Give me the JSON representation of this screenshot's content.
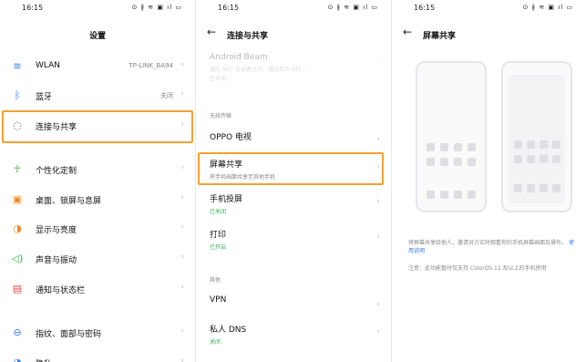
{
  "status": {
    "time": "16:15",
    "icons": "⊙ ∦ ≋ ▣ ıl ▭"
  },
  "settings": {
    "title": "设置",
    "items": [
      {
        "icon": "wifi-icon",
        "glyph": "≋",
        "color": "#2d7bf6",
        "label": "WLAN",
        "value": "TP-LINK_BA94"
      },
      {
        "icon": "bluetooth-icon",
        "glyph": "ᛒ",
        "color": "#2d7bf6",
        "label": "蓝牙",
        "value": "关闭"
      },
      {
        "icon": "connection-share-icon",
        "glyph": "◌",
        "color": "#555555",
        "label": "连接与共享",
        "value": ""
      },
      {
        "icon": "personalization-icon",
        "glyph": "☥",
        "color": "#2db04b",
        "label": "个性化定制",
        "value": ""
      },
      {
        "icon": "wallpaper-icon",
        "glyph": "▣",
        "color": "#f08a24",
        "label": "桌面、锁屏与息屏",
        "value": ""
      },
      {
        "icon": "display-icon",
        "glyph": "◑",
        "color": "#f08a24",
        "label": "显示与亮度",
        "value": ""
      },
      {
        "icon": "sound-icon",
        "glyph": "◁)",
        "color": "#2db04b",
        "label": "声音与振动",
        "value": ""
      },
      {
        "icon": "notification-icon",
        "glyph": "▤",
        "color": "#e04b4b",
        "label": "通知与状态栏",
        "value": ""
      },
      {
        "icon": "fingerprint-icon",
        "glyph": "⊖",
        "color": "#2d7bf6",
        "label": "指纹、面部与密码",
        "value": ""
      },
      {
        "icon": "privacy-icon",
        "glyph": "◔",
        "color": "#2d7bf6",
        "label": "隐私",
        "value": ""
      }
    ]
  },
  "connection": {
    "title": "连接与共享",
    "android_beam": {
      "title": "Android Beam",
      "subtitle1": "通过 NFC 在设备之间，通过双方 NFC，",
      "subtitle2": "已关闭"
    },
    "section_wireless": "无线传输",
    "oppo_tv": "OPPO 电视",
    "screen_share": {
      "title": "屏幕共享",
      "subtitle": "将手机画面共享至其他手机"
    },
    "cast": {
      "title": "手机投屏",
      "status": "已关闭"
    },
    "print": {
      "title": "打印",
      "status": "已开启"
    },
    "section_other": "其他",
    "vpn": "VPN",
    "dns": {
      "title": "私人 DNS",
      "status": "关闭"
    }
  },
  "screenshare": {
    "title": "屏幕共享",
    "description": "将屏幕共享给他人，邀请对方实时观看你的手机屏幕画面及操作。",
    "link": "使用说明",
    "note": "注意：此功能暂时仅支持 ColorOS 11 及以上的手机使用"
  }
}
